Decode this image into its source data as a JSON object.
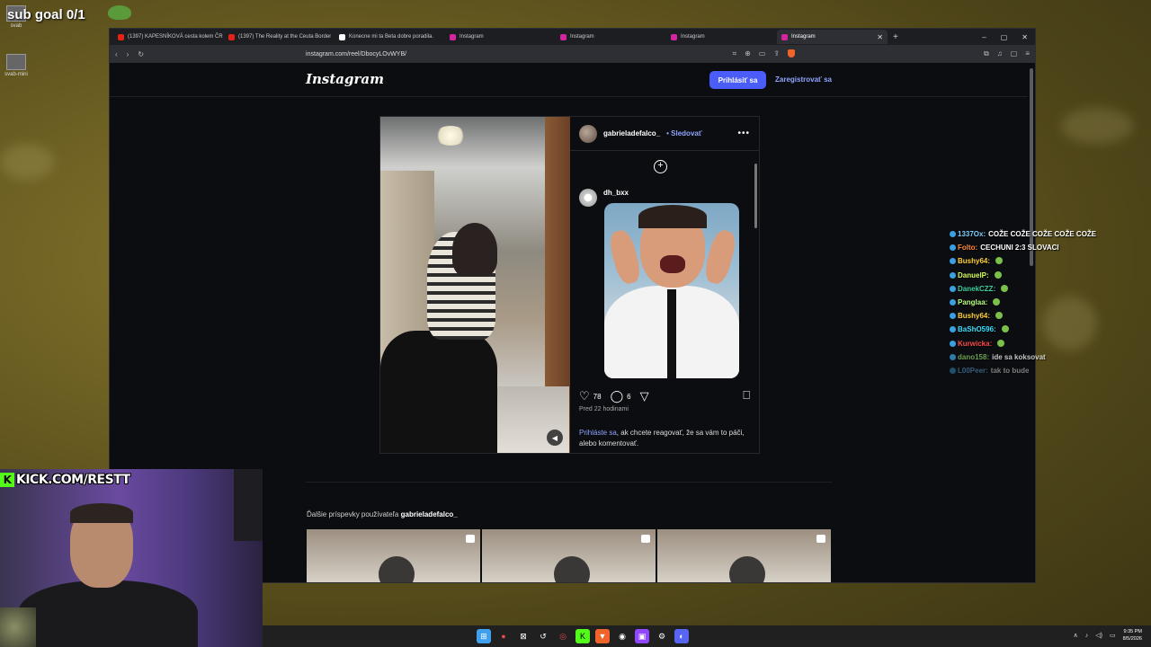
{
  "overlay": {
    "sub_goal": "sub goal 0/1",
    "desktop_icons": [
      "svab",
      "svab-mini"
    ],
    "kick_label": "KICK.COM/RESTT"
  },
  "browser": {
    "tabs": [
      {
        "label": "(1397) KAPESNÍKOVÁ cesta kolem ČR",
        "favicon": "youtube",
        "color": "#e62117"
      },
      {
        "label": "(1397) The Reality at the Ceuta Border",
        "favicon": "youtube",
        "color": "#e62117"
      },
      {
        "label": "Konecne mi ta Beta dobre poradila.",
        "favicon": "tiktok",
        "color": "#ffffff"
      },
      {
        "label": "Instagram",
        "favicon": "instagram",
        "color": "#d6249f"
      },
      {
        "label": "Instagram",
        "favicon": "instagram",
        "color": "#d6249f"
      },
      {
        "label": "Instagram",
        "favicon": "instagram",
        "color": "#d6249f"
      },
      {
        "label": "Instagram",
        "favicon": "instagram",
        "color": "#d6249f",
        "active": true
      }
    ],
    "new_tab": "+",
    "url": "instagram.com/reel/DbocyLOvWYB/"
  },
  "instagram": {
    "logo": "Instagram",
    "login_button": "Prihlásiť sa",
    "register_link": "Zaregistrovať sa",
    "post": {
      "username": "gabrieladefalco_",
      "follow": "• Sledovať",
      "comment_user": "dh_bxx",
      "likes": "78",
      "comments": "6",
      "time": "Pred 22 hodinami",
      "login_link": "Prihláste sa",
      "login_text": ", ak chcete reagovať, že sa vám to páči, alebo komentovať."
    },
    "more_posts_prefix": "Ďalšie príspevky používateľa",
    "more_posts_user": "gabrieladefalco_"
  },
  "chat": [
    {
      "user": "1337Ox:",
      "text": "COŽE COŽE COŽE COŽE COŽE",
      "color": "#7fd0ff"
    },
    {
      "user": "Folto:",
      "text": "CECHUNI 2:3 SLOVACI",
      "color": "#ff8c3a"
    },
    {
      "user": "Bushy64:",
      "text": "",
      "color": "#ffd23a"
    },
    {
      "user": "DanuelP:",
      "text": "",
      "color": "#d8ff5a"
    },
    {
      "user": "DanekCZZ:",
      "text": "",
      "color": "#3ad0a0"
    },
    {
      "user": "Panglaa:",
      "text": "",
      "color": "#b8ff7a"
    },
    {
      "user": "Bushy64:",
      "text": "",
      "color": "#ffd23a"
    },
    {
      "user": "BaShO596:",
      "text": "",
      "color": "#39e0ff"
    },
    {
      "user": "Kurwicka:",
      "text": "",
      "color": "#ff4a4a"
    },
    {
      "user": "dano158:",
      "text": "ide sa koksovat",
      "color": "#8ad06a"
    },
    {
      "user": "L00Peer:",
      "text": "tak to bude",
      "color": "#6ac0ff"
    }
  ],
  "taskbar": {
    "time": "9:35 PM",
    "date": "8/5/2026"
  }
}
